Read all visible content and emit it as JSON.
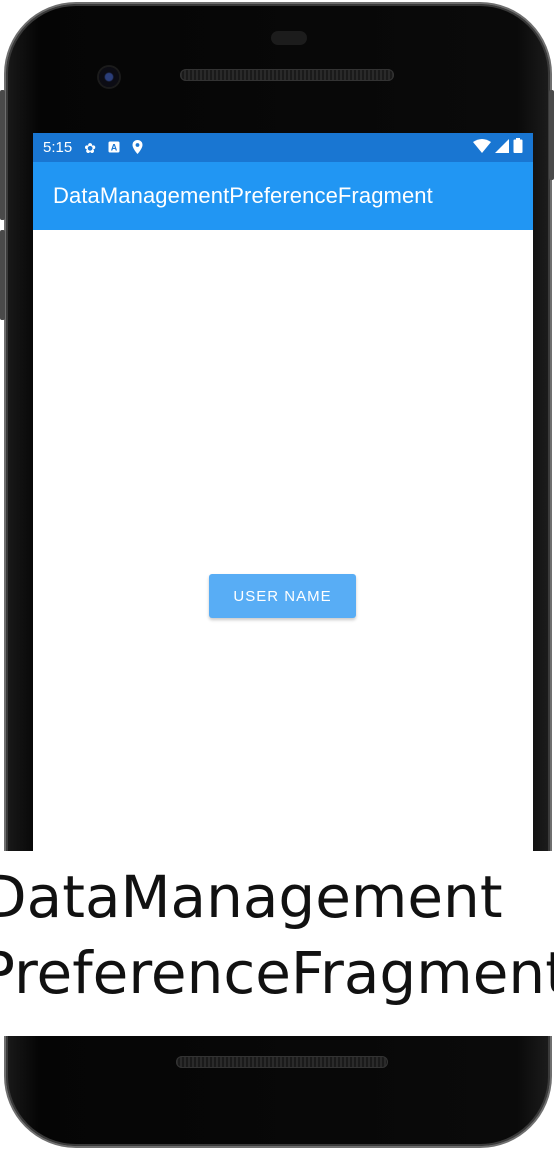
{
  "status_bar": {
    "time": "5:15",
    "left_icons": [
      "gear-icon",
      "a-icon",
      "location-icon"
    ],
    "right_icons": [
      "wifi-icon",
      "signal-icon",
      "battery-icon"
    ]
  },
  "app_bar": {
    "title": "DataManagementPreferenceFragment"
  },
  "main": {
    "user_name_button": "USER NAME"
  },
  "caption": {
    "line1": "DataManagement",
    "line2": "PreferenceFragment"
  },
  "colors": {
    "status_bar": "#1976D2",
    "app_bar": "#2196F3",
    "button": "#58ADF5"
  }
}
